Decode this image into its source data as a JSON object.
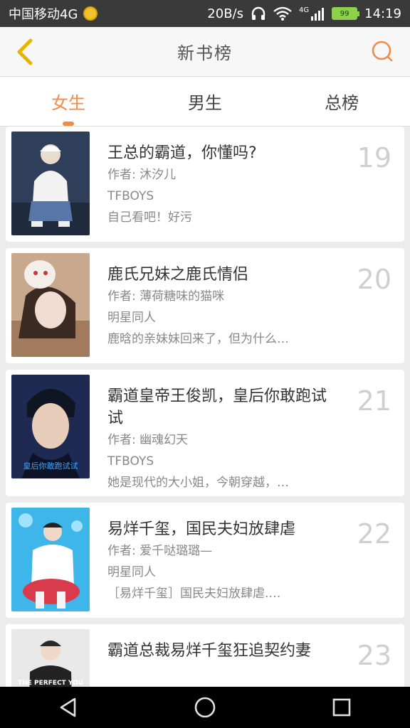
{
  "status_bar": {
    "carrier": "中国移动4G",
    "speed": "20B/s",
    "battery": "99",
    "time": "14:19",
    "network": "4G"
  },
  "header": {
    "title": "新书榜"
  },
  "tabs": [
    {
      "label": "女生",
      "active": true
    },
    {
      "label": "男生",
      "active": false
    },
    {
      "label": "总榜",
      "active": false
    }
  ],
  "books": [
    {
      "title": "王总的霸道，你懂吗?",
      "author": "作者: 沐汐儿",
      "category": "TFBOYS",
      "desc": "自己看吧！好污",
      "rank": "19"
    },
    {
      "title": "鹿氏兄妹之鹿氏情侣",
      "author": "作者: 薄荷糖味的猫咪",
      "category": "明星同人",
      "desc": "鹿晗的亲妹妹回来了，但为什么…",
      "rank": "20"
    },
    {
      "title": "霸道皇帝王俊凯，皇后你敢跑试试",
      "author": "作者: 幽魂幻天",
      "category": "TFBOYS",
      "desc": "她是现代的大小姐，今朝穿越，…",
      "rank": "21",
      "cover_text": "皇后你敢跑试试"
    },
    {
      "title": "易烊千玺，国民夫妇放肆虐",
      "author": "作者: 爱千哒璐璐—",
      "category": "明星同人",
      "desc": "［易烊千玺］国民夫妇放肆虐.…",
      "rank": "22"
    },
    {
      "title": "霸道总裁易烊千玺狂追契约妻",
      "author": "",
      "category": "",
      "desc": "",
      "rank": "23",
      "cover_text": "THE PERFECT YOU"
    }
  ],
  "colors": {
    "accent": "#f08c4a",
    "back_arrow": "#e6b500"
  }
}
